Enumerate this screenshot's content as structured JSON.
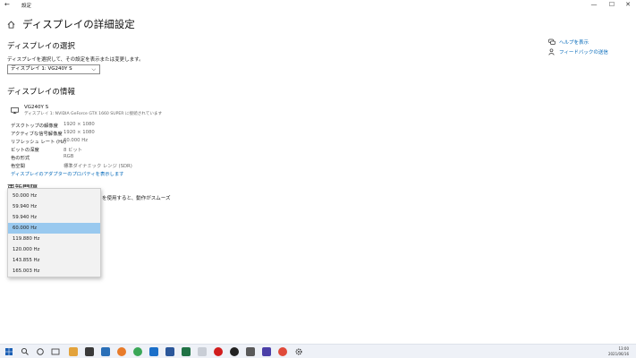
{
  "window": {
    "back_glyph": "←",
    "title": "設定",
    "minimize_glyph": "—",
    "maximize_glyph": "☐",
    "close_glyph": "✕"
  },
  "page": {
    "title": "ディスプレイの詳細設定"
  },
  "select_display": {
    "heading": "ディスプレイの選択",
    "instruction": "ディスプレイを選択して、その設定を表示または変更します。",
    "selected": "ディスプレイ 1: VG240Y S",
    "chevron": "⌵"
  },
  "info": {
    "heading": "ディスプレイの情報",
    "monitor_name": "VG240Y S",
    "monitor_sub": "ディスプレイ 1: NVIDIA GeForce GTX 1660 SUPER に接続されています",
    "rows": [
      {
        "label": "デスクトップの解像度",
        "value": "1920 × 1080"
      },
      {
        "label": "アクティブな信号解像度",
        "value": "1920 × 1080"
      },
      {
        "label": "リフレッシュ レート (Hz)",
        "value": "60.000 Hz"
      },
      {
        "label": "ビットの深度",
        "value": "8 ビット"
      },
      {
        "label": "色の形式",
        "value": "RGB"
      },
      {
        "label": "色空間",
        "value": "標準ダイナミック レンジ (SDR)"
      }
    ],
    "adapter_link": "ディスプレイのアダプターのプロパティを表示します"
  },
  "refresh": {
    "heading": "更新間隔",
    "partial_text": "を使用すると、動作がスムーズ",
    "options": [
      "50.000 Hz",
      "59.940 Hz",
      "59.940 Hz",
      "60.000 Hz",
      "119.880 Hz",
      "120.000 Hz",
      "143.855 Hz",
      "165.003 Hz"
    ],
    "selected_index": 3
  },
  "sidebar": {
    "help_link": "ヘルプを表示",
    "feedback_link": "フィードバックの送信"
  },
  "taskbar": {
    "time": "13:00",
    "date": "2021/06/16"
  },
  "colors": {
    "accent": "#0067b8",
    "selection": "#99c9ef"
  }
}
